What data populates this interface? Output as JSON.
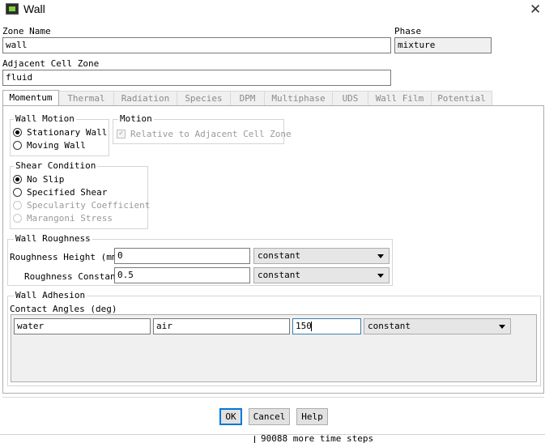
{
  "window": {
    "title": "Wall",
    "icon": "fluent-app-icon",
    "close_icon": "close-icon",
    "close_glyph": "✕"
  },
  "zone": {
    "label": "Zone Name",
    "value": "wall"
  },
  "phase": {
    "label": "Phase",
    "value": "mixture"
  },
  "adjacent": {
    "label": "Adjacent Cell Zone",
    "value": "fluid"
  },
  "tabs": [
    "Momentum",
    "Thermal",
    "Radiation",
    "Species",
    "DPM",
    "Multiphase",
    "UDS",
    "Wall Film",
    "Potential"
  ],
  "active_tab": "Momentum",
  "wall_motion": {
    "title": "Wall Motion",
    "options": [
      "Stationary Wall",
      "Moving Wall"
    ],
    "selected": "Stationary Wall"
  },
  "motion": {
    "title": "Motion",
    "checkbox_label": "Relative to Adjacent Cell Zone",
    "checked": true,
    "enabled": false
  },
  "shear": {
    "title": "Shear Condition",
    "options": [
      "No Slip",
      "Specified Shear",
      "Specularity Coefficient",
      "Marangoni Stress"
    ],
    "selected": "No Slip",
    "disabled": [
      "Specularity Coefficient",
      "Marangoni Stress"
    ]
  },
  "roughness": {
    "title": "Wall Roughness",
    "height": {
      "label": "Roughness Height (mm)",
      "value": "0",
      "method": "constant"
    },
    "constant": {
      "label": "Roughness Constant",
      "value": "0.5",
      "method": "constant"
    }
  },
  "adhesion": {
    "title": "Wall Adhesion",
    "contact_label": "Contact Angles (deg)",
    "row": {
      "phase1": "water",
      "phase2": "air",
      "angle": "150",
      "method": "constant"
    }
  },
  "buttons": {
    "ok": "OK",
    "cancel": "Cancel",
    "help": "Help"
  },
  "background_text": "90088 more time steps"
}
